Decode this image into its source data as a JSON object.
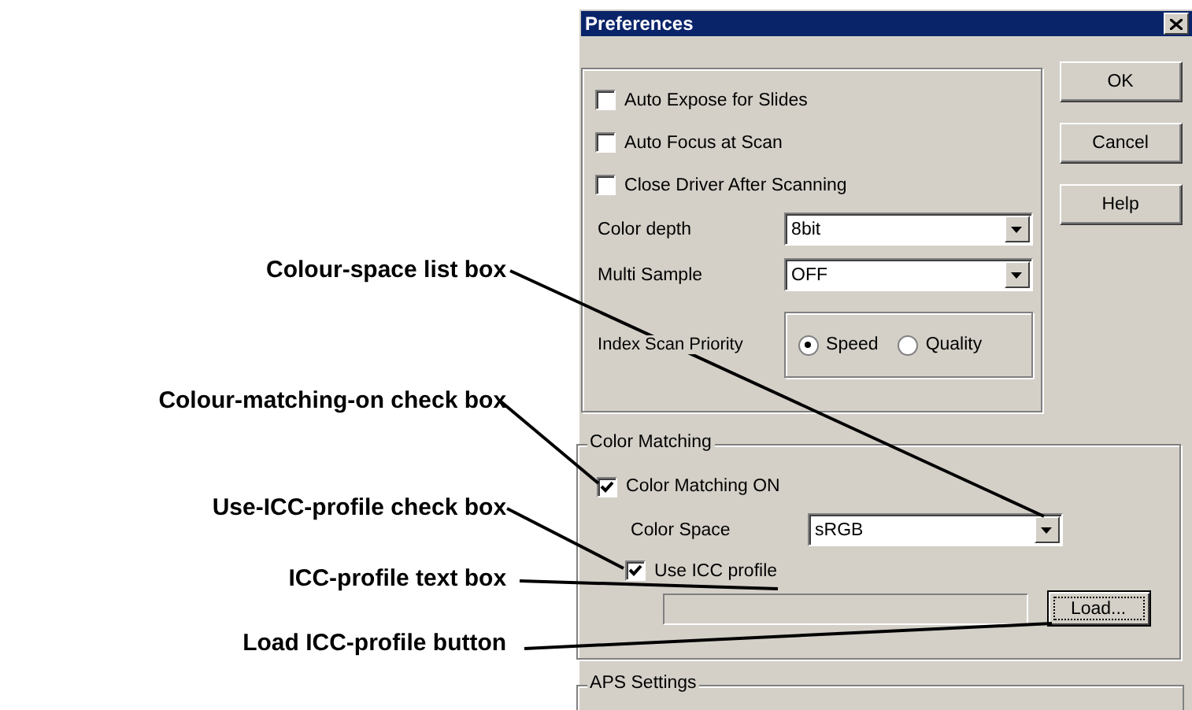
{
  "window": {
    "title": "Preferences"
  },
  "options": {
    "checkboxes": [
      {
        "label": "Auto Expose for Slides",
        "checked": false
      },
      {
        "label": "Auto Focus at Scan",
        "checked": false
      },
      {
        "label": "Close Driver After Scanning",
        "checked": false
      }
    ],
    "dropdowns": [
      {
        "label": "Color depth",
        "value": "8bit"
      },
      {
        "label": "Multi Sample",
        "value": "OFF"
      }
    ],
    "index_scan_priority": {
      "label": "Index Scan Priority",
      "options": [
        {
          "label": "Speed",
          "selected": true
        },
        {
          "label": "Quality",
          "selected": false
        }
      ]
    }
  },
  "buttons": [
    {
      "label": "OK"
    },
    {
      "label": "Cancel"
    },
    {
      "label": "Help"
    }
  ],
  "color_matching": {
    "title": "Color Matching",
    "enabled": {
      "label": "Color Matching ON",
      "checked": true
    },
    "color_space": {
      "label": "Color Space",
      "value": "sRGB"
    },
    "use_icc": {
      "label": "Use ICC profile",
      "checked": true
    },
    "load_button": "Load..."
  },
  "aps_settings": {
    "title": "APS Settings"
  },
  "callouts": [
    {
      "text": "Colour-space list box"
    },
    {
      "text": "Colour-matching-on check box"
    },
    {
      "text": "Use-ICC-profile check box"
    },
    {
      "text": "ICC-profile text box"
    },
    {
      "text": "Load ICC-profile button"
    }
  ]
}
